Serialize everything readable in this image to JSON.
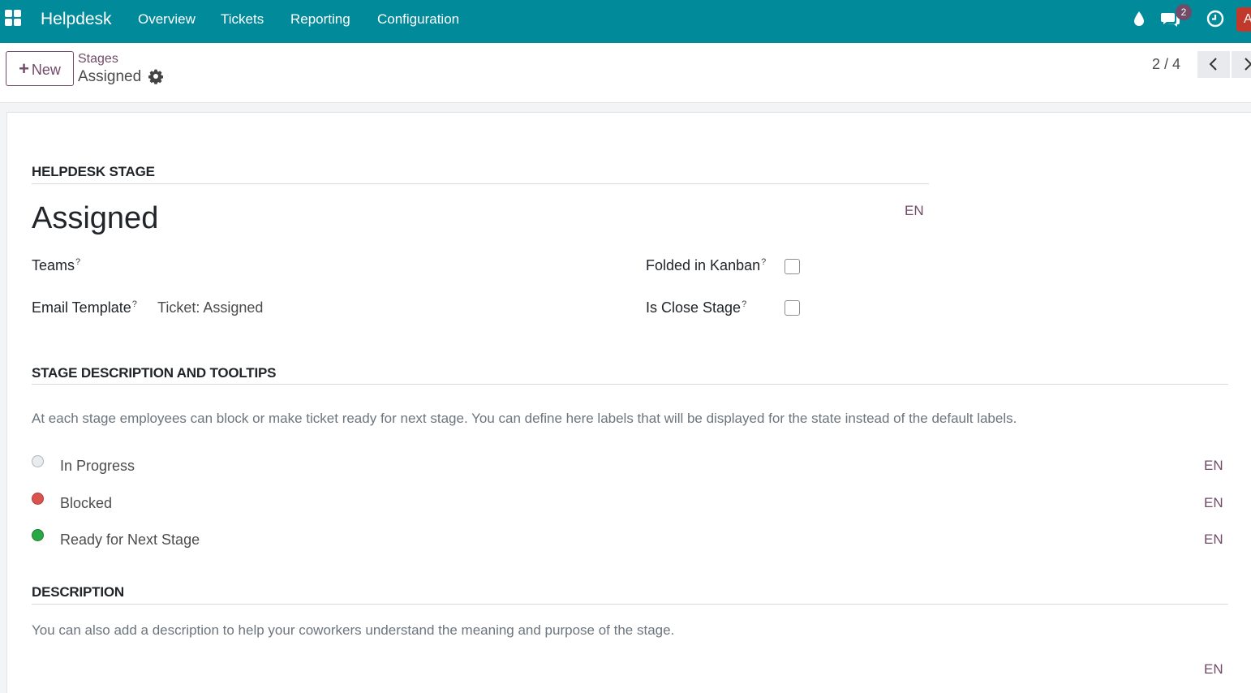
{
  "navbar": {
    "brand": "Helpdesk",
    "menu": [
      "Overview",
      "Tickets",
      "Reporting",
      "Configuration"
    ],
    "messages_badge": "2",
    "avatar_initial": "A",
    "icons": [
      "apps-grid-icon",
      "drop-icon",
      "chat-icon",
      "clock-icon"
    ]
  },
  "control_panel": {
    "new_label": "New",
    "breadcrumb_parent": "Stages",
    "breadcrumb_current": "Assigned",
    "pager": "2 / 4"
  },
  "form": {
    "section1_title": "HELPDESK STAGE",
    "stage_name": "Assigned",
    "lang": "EN",
    "teams_label": "Teams",
    "email_template_label": "Email Template",
    "email_template_value": "Ticket: Assigned",
    "folded_label": "Folded in Kanban",
    "close_stage_label": "Is Close Stage",
    "folded_checked": false,
    "close_stage_checked": false,
    "help_mark": "?",
    "section2_title": "STAGE DESCRIPTION AND TOOLTIPS",
    "section2_text": "At each stage employees can block or make ticket ready for next stage. You can define here labels that will be displayed for the state instead of the default labels.",
    "states": [
      {
        "label": "In Progress",
        "color": "#e9ecef"
      },
      {
        "label": "Blocked",
        "color": "#d9534f"
      },
      {
        "label": "Ready for Next Stage",
        "color": "#28a745"
      }
    ],
    "section3_title": "DESCRIPTION",
    "section3_text": "You can also add a description to help your coworkers understand the meaning and purpose of the stage."
  },
  "colors": {
    "navbar": "#018a9a",
    "accent": "#714b67"
  }
}
